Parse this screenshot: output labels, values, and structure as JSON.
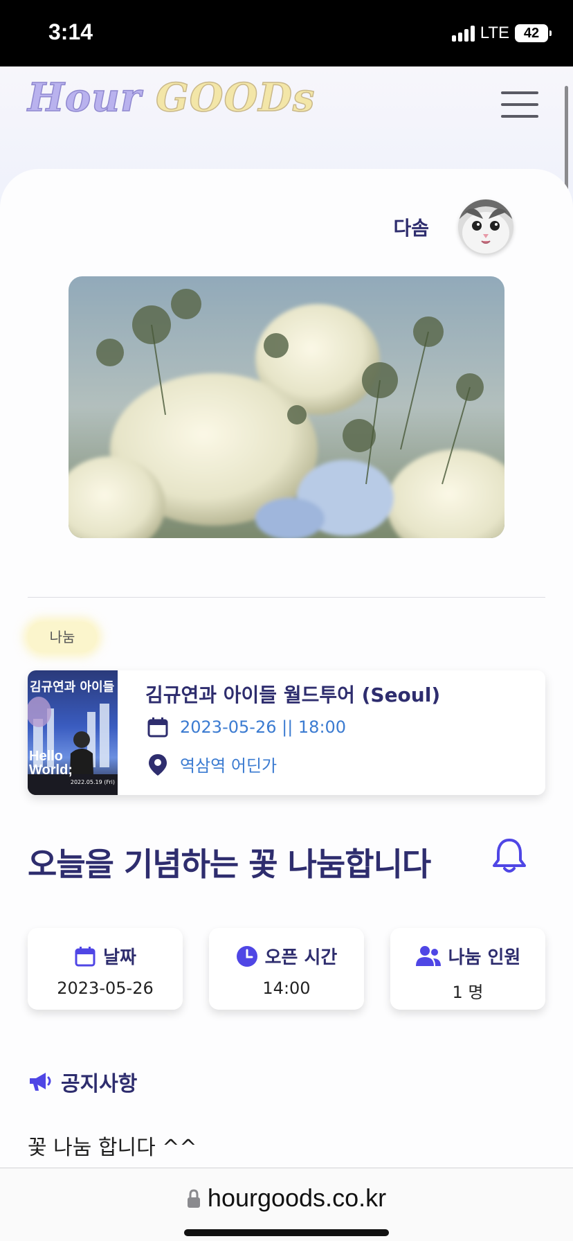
{
  "status_bar": {
    "time": "3:14",
    "network": "LTE",
    "battery": "42"
  },
  "header": {
    "logo_part1": "Hour",
    "logo_part2": "GOODs",
    "menu_icon": "hamburger-menu-icon"
  },
  "author": {
    "name": "다솜",
    "avatar": "cat-avatar"
  },
  "divider": true,
  "category": "나눔",
  "event": {
    "thumb_title": "김규연과 아이들",
    "thumb_hello": "Hello World;",
    "thumb_date": "2022.05.19 (Fri)",
    "title": "김규연과 아이들 월드투어 (Seoul)",
    "datetime": "2023-05-26 || 18:00",
    "place": "역삼역 어딘가"
  },
  "post": {
    "title": "오늘을 기념하는 꽃 나눔합니다"
  },
  "info": {
    "date_label": "날짜",
    "date_value": "2023-05-26",
    "time_label": "오픈 시간",
    "time_value": "14:00",
    "people_label": "나눔 인원",
    "people_value": "1 명"
  },
  "notice": {
    "title": "공지사항",
    "body": "꽃 나눔 합니다 ^^"
  },
  "browser": {
    "url": "hourgoods.co.kr"
  },
  "colors": {
    "primary": "#2e2d6e",
    "accent": "#4f46e5",
    "link": "#3b7bd1",
    "chip": "#fbf5cc"
  }
}
